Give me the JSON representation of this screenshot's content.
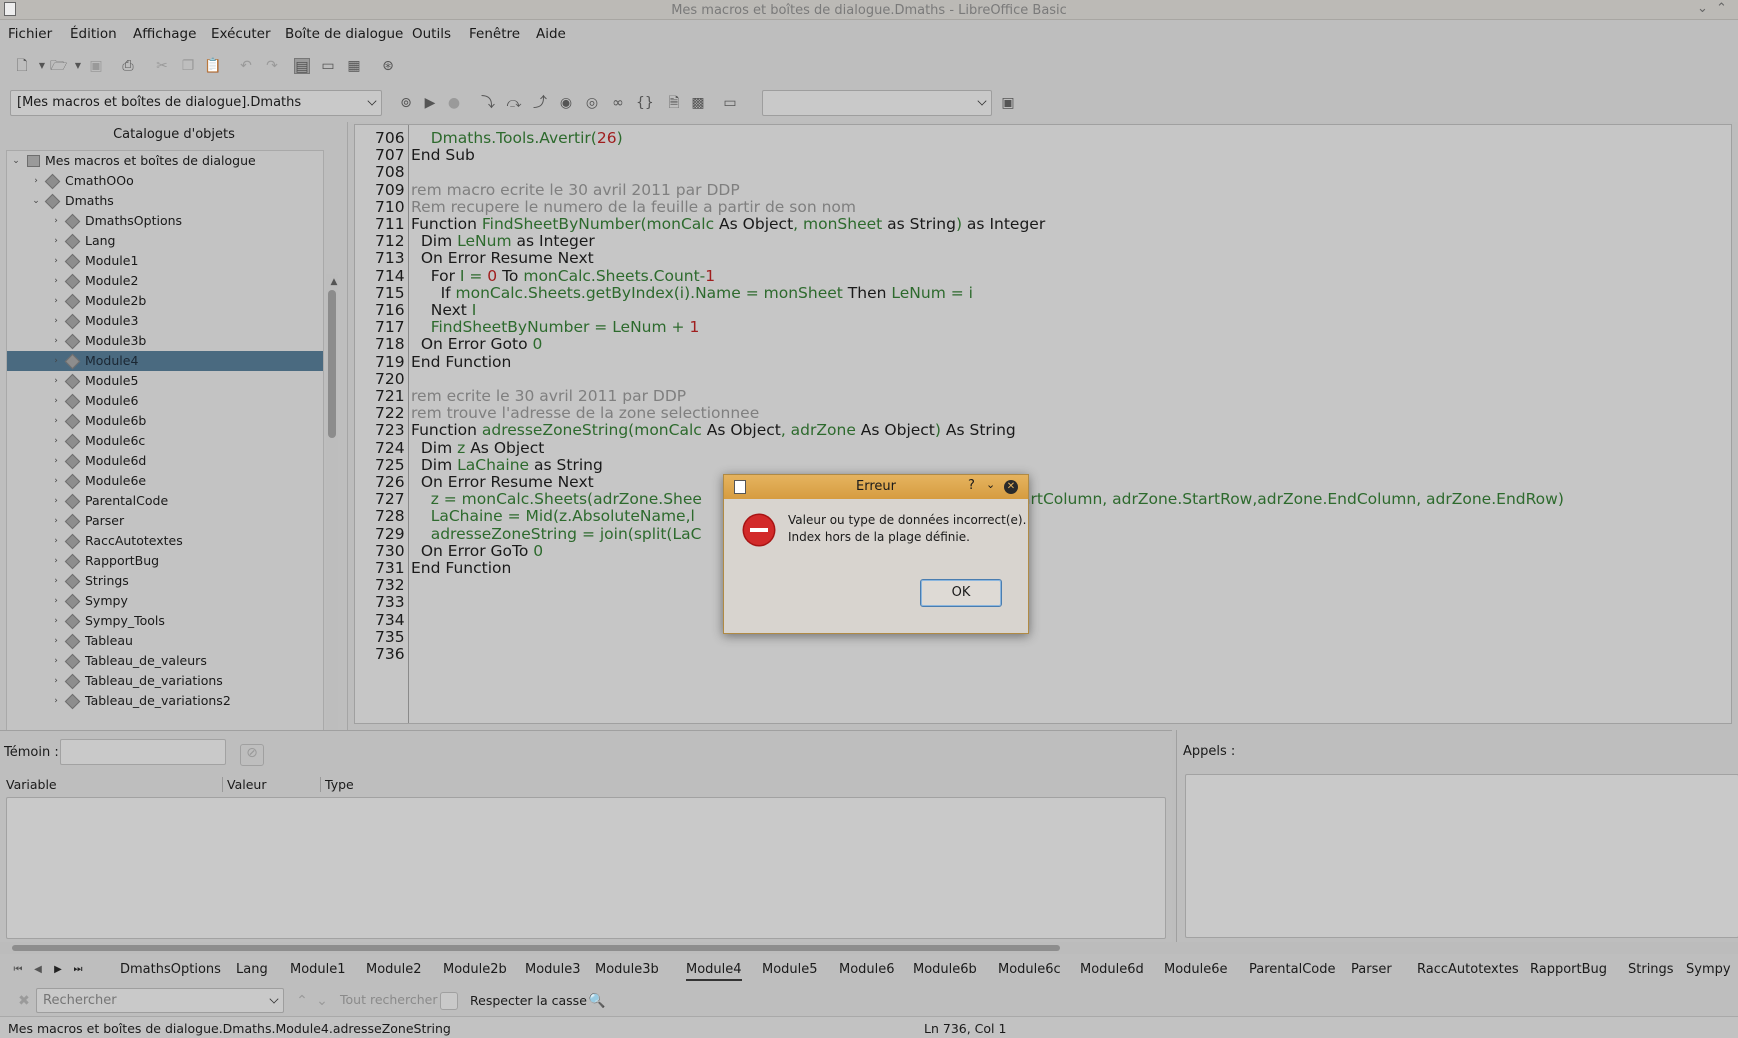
{
  "window": {
    "title": "Mes macros et boîtes de dialogue.Dmaths - LibreOffice Basic"
  },
  "menu": [
    "Fichier",
    "Édition",
    "Affichage",
    "Exécuter",
    "Boîte de dialogue",
    "Outils",
    "Fenêtre",
    "Aide"
  ],
  "library_selector": {
    "value": "[Mes macros et boîtes de dialogue].Dmaths"
  },
  "object_catalog": {
    "title": "Catalogue d'objets",
    "root": "Mes macros et boîtes de dialogue",
    "libraries": [
      "CmathOOo",
      "Dmaths"
    ],
    "modules": [
      "DmathsOptions",
      "Lang",
      "Module1",
      "Module2",
      "Module2b",
      "Module3",
      "Module3b",
      "Module4",
      "Module5",
      "Module6",
      "Module6b",
      "Module6c",
      "Module6d",
      "Module6e",
      "ParentalCode",
      "Parser",
      "RaccAutotextes",
      "RapportBug",
      "Strings",
      "Sympy",
      "Sympy_Tools",
      "Tableau",
      "Tableau_de_valeurs",
      "Tableau_de_variations",
      "Tableau_de_variations2"
    ],
    "selected": "Module4"
  },
  "editor": {
    "lines": [
      {
        "n": "706",
        "t": "    Dmaths.Tools.Avertir(26)"
      },
      {
        "n": "707",
        "t": "End Sub"
      },
      {
        "n": "708",
        "t": ""
      },
      {
        "n": "709",
        "t": "rem macro ecrite le 30 avril 2011 par DDP"
      },
      {
        "n": "710",
        "t": "Rem recupere le numero de la feuille a partir de son nom"
      },
      {
        "n": "711",
        "t": "Function FindSheetByNumber(monCalc As Object, monSheet as String) as Integer"
      },
      {
        "n": "712",
        "t": "  Dim LeNum as Integer"
      },
      {
        "n": "713",
        "t": "  On Error Resume Next"
      },
      {
        "n": "714",
        "t": "    For I = 0 To monCalc.Sheets.Count-1"
      },
      {
        "n": "715",
        "t": "      If monCalc.Sheets.getByIndex(i).Name = monSheet Then LeNum = i"
      },
      {
        "n": "716",
        "t": "    Next I"
      },
      {
        "n": "717",
        "t": "    FindSheetByNumber = LeNum + 1"
      },
      {
        "n": "718",
        "t": "  On Error Goto 0"
      },
      {
        "n": "719",
        "t": "End Function"
      },
      {
        "n": "720",
        "t": ""
      },
      {
        "n": "721",
        "t": "rem ecrite le 30 avril 2011 par DDP"
      },
      {
        "n": "722",
        "t": "rem trouve l'adresse de la zone selectionnee"
      },
      {
        "n": "723",
        "t": "Function adresseZoneString(monCalc As Object, adrZone As Object) As String"
      },
      {
        "n": "724",
        "t": "  Dim z As Object"
      },
      {
        "n": "725",
        "t": "  Dim LaChaine as String"
      },
      {
        "n": "726",
        "t": "  On Error Resume Next"
      },
      {
        "n": "727",
        "t": "    z = monCalc.Sheets(adrZone.Shee"
      },
      {
        "n": "728",
        "t": "    LaChaine = Mid(z.AbsoluteName,l"
      },
      {
        "n": "729",
        "t": "    adresseZoneString = join(split(LaC"
      },
      {
        "n": "730",
        "t": "  On Error GoTo 0"
      },
      {
        "n": "731",
        "t": "End Function"
      },
      {
        "n": "732",
        "t": ""
      },
      {
        "n": "733",
        "t": ""
      },
      {
        "n": "734",
        "t": ""
      },
      {
        "n": "735",
        "t": ""
      },
      {
        "n": "736",
        "t": ""
      }
    ],
    "line727_tail": "artColumn, adrZone.StartRow,adrZone.EndColumn, adrZone.EndRow)"
  },
  "watch": {
    "label": "Témoin :",
    "columns": [
      "Variable",
      "Valeur",
      "Type"
    ]
  },
  "calls": {
    "label": "Appels :"
  },
  "module_tabs": [
    "DmathsOptions",
    "Lang",
    "Module1",
    "Module2",
    "Module2b",
    "Module3",
    "Module3b",
    "Module4",
    "Module5",
    "Module6",
    "Module6b",
    "Module6c",
    "Module6d",
    "Module6e",
    "ParentalCode",
    "Parser",
    "RaccAutotextes",
    "RapportBug",
    "Strings",
    "Sympy"
  ],
  "active_tab": "Module4",
  "find": {
    "placeholder": "Rechercher",
    "find_all": "Tout rechercher",
    "match_case": "Respecter la casse"
  },
  "status": {
    "path": "Mes macros et boîtes de dialogue.Dmaths.Module4.adresseZoneString",
    "position": "Ln 736, Col 1"
  },
  "dialog": {
    "title": "Erreur",
    "help": "?",
    "line1": "Valeur ou type de données incorrect(e).",
    "line2": "Index hors de la plage définie.",
    "ok": "OK"
  }
}
